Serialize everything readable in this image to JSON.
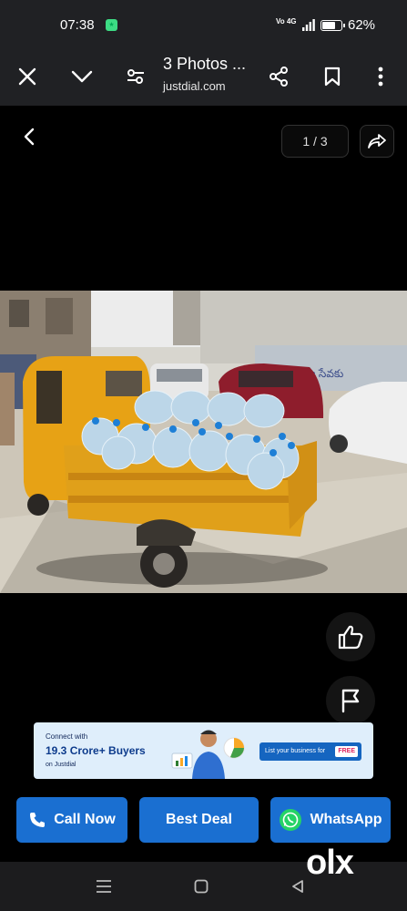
{
  "status_bar": {
    "time": "07:38",
    "network": "Vo 4G",
    "battery": "62%",
    "battery_level": 0.62
  },
  "app_bar": {
    "title": "3 Photos ...",
    "subtitle": "justdial.com"
  },
  "viewer": {
    "counter": "1 / 3"
  },
  "photo": {
    "wall_text": "ప్రజా సేవకు"
  },
  "banner": {
    "line1": "Connect with",
    "line2": "19.3 Crore+ Buyers",
    "line3": "on  Justdial",
    "cta": "List your business for",
    "cta_badge": "FREE"
  },
  "actions": {
    "call": "Call Now",
    "deal": "Best Deal",
    "whatsapp": "WhatsApp"
  },
  "watermark": "olx",
  "colors": {
    "primary": "#1a6fd1",
    "whatsapp": "#25d366",
    "dark": "#202124"
  }
}
